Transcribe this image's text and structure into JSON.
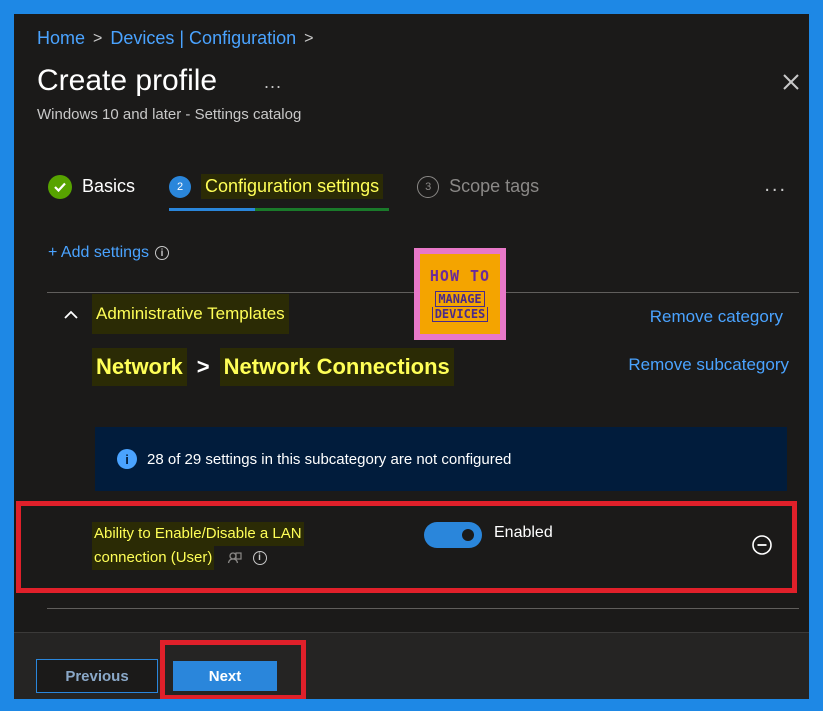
{
  "breadcrumb": {
    "items": [
      "Home",
      "Devices | Configuration"
    ],
    "separator": ">"
  },
  "header": {
    "title": "Create profile",
    "more": "...",
    "subtitle": "Windows 10 and later - Settings catalog",
    "close_icon": "close-icon"
  },
  "steps": [
    {
      "number": "",
      "label": "Basics",
      "state": "done"
    },
    {
      "number": "2",
      "label": "Configuration settings",
      "state": "active"
    },
    {
      "number": "3",
      "label": "Scope tags",
      "state": "inactive"
    }
  ],
  "steps_more": "...",
  "add_settings": {
    "label": "+ Add settings",
    "icon": "info-icon"
  },
  "logo": {
    "line1": "HOW TO",
    "line2": "MANAGE",
    "line3": "DEVICES"
  },
  "category": {
    "name": "Administrative Templates",
    "remove_label": "Remove category"
  },
  "subcategory": {
    "parent": "Network",
    "separator": ">",
    "name": "Network Connections",
    "remove_label": "Remove subcategory"
  },
  "info_banner": {
    "text": "28 of 29 settings in this subcategory are not configured"
  },
  "setting": {
    "name_line1": "Ability to Enable/Disable a LAN",
    "name_line2": "connection (User)",
    "state_label": "Enabled",
    "enabled": true
  },
  "footer": {
    "previous_label": "Previous",
    "next_label": "Next"
  },
  "colors": {
    "accent": "#2a86db",
    "link": "#4aa3ff",
    "highlight_text": "#ffff57",
    "annotation_red": "#e0202a",
    "success": "#57a300"
  }
}
